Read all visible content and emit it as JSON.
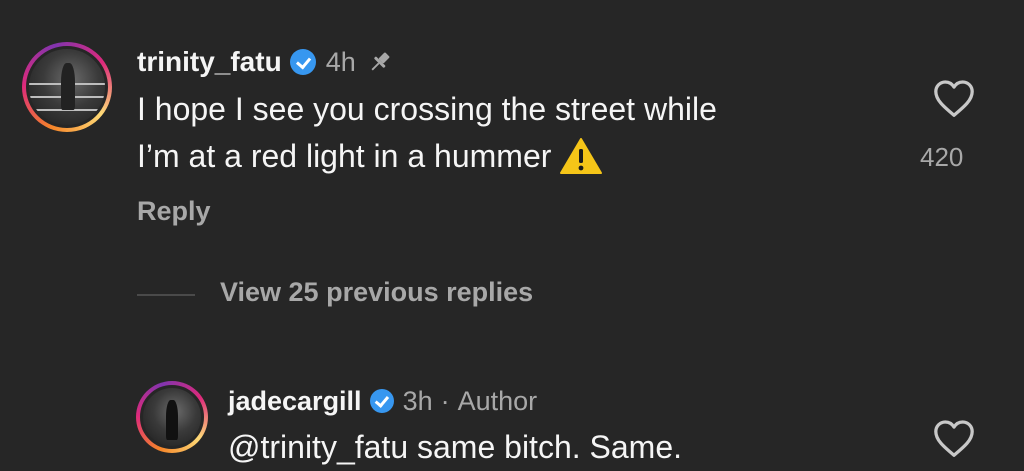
{
  "comment": {
    "username": "trinity_fatu",
    "time": "4h",
    "text_line1": "I hope I see you crossing the street while",
    "text_line2": "I’m at a red light in a hummer",
    "reply_label": "Reply",
    "like_count": "420",
    "icons": [
      "verified-badge",
      "pin-icon",
      "warning-icon",
      "heart-icon"
    ]
  },
  "view_previous": {
    "label": "View 25 previous replies"
  },
  "reply_comment": {
    "username": "jadecargill",
    "time": "3h",
    "separator": "·",
    "author_label": "Author",
    "text": "@trinity_fatu same bitch. Same.",
    "icons": [
      "verified-badge",
      "heart-icon"
    ]
  },
  "colors": {
    "background": "#262626",
    "text": "#f5f5f5",
    "secondary": "#a8a8a8",
    "verified": "#3797f0",
    "warning": "#f5c518"
  }
}
